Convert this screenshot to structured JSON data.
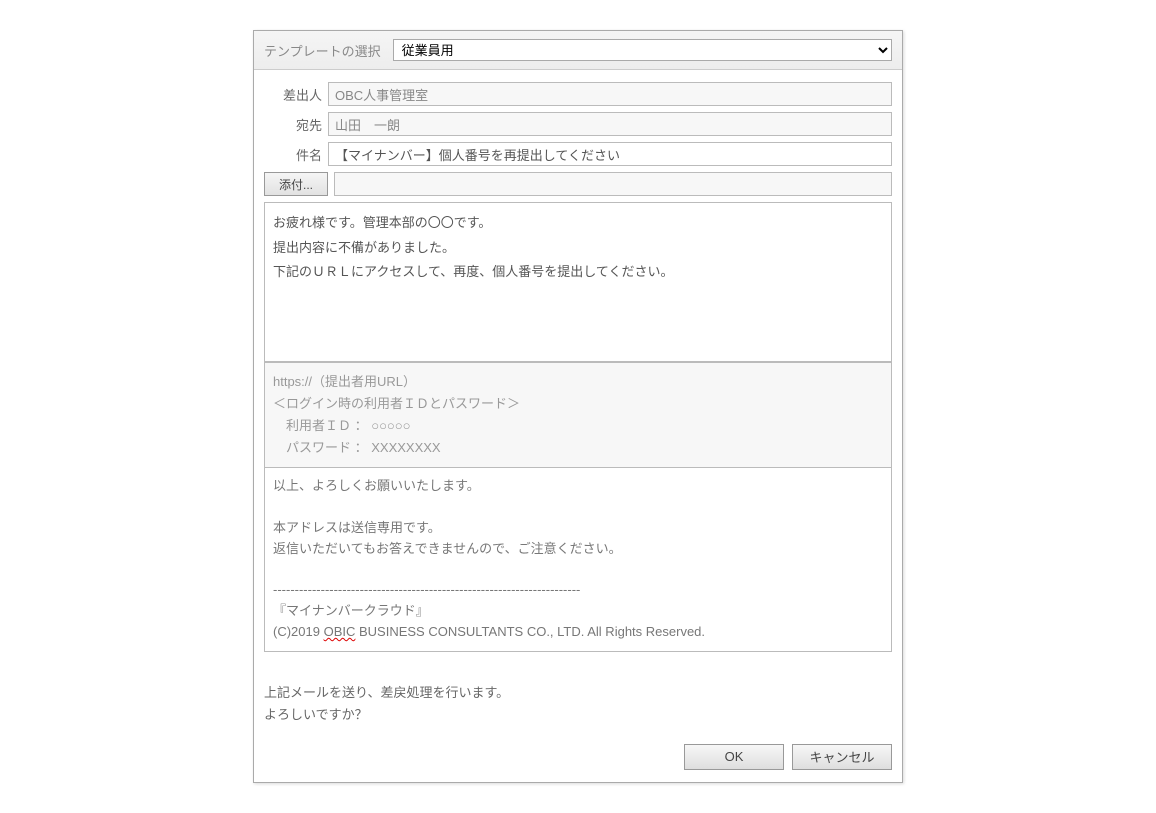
{
  "header": {
    "template_label": "テンプレートの選択",
    "template_selected": "従業員用"
  },
  "fields": {
    "sender_label": "差出人",
    "sender_value": "OBC人事管理室",
    "recipient_label": "宛先",
    "recipient_value": "山田　一朗",
    "subject_label": "件名",
    "subject_value": "【マイナンバー】個人番号を再提出してください",
    "attach_label": "添付...",
    "attach_value": ""
  },
  "body": {
    "editable": "お疲れ様です。管理本部の〇〇です。\n提出内容に不備がありました。\n下記のＵＲＬにアクセスして、再度、個人番号を提出してください。",
    "readonly": "https://（提出者用URL）\n＜ログイン時の利用者ＩＤとパスワード＞\n　利用者ＩＤ ： ○○○○○\n　パスワード ： XXXXXXXX",
    "footer_line1": "以上、よろしくお願いいたします。",
    "footer_line2": "本アドレスは送信専用です。",
    "footer_line3": "返信いただいてもお答えできませんので、ご注意ください。",
    "footer_divider": "-----------------------------------------------------------------------",
    "footer_line4": "『マイナンバークラウド』",
    "footer_line5a": "(C)2019 ",
    "footer_line5b": "OBIC",
    "footer_line5c": " BUSINESS CONSULTANTS CO., LTD. All Rights Reserved."
  },
  "confirm": {
    "line1": "上記メールを送り、差戻処理を行います。",
    "line2": "よろしいですか？"
  },
  "buttons": {
    "ok": "OK",
    "cancel": "キャンセル"
  }
}
